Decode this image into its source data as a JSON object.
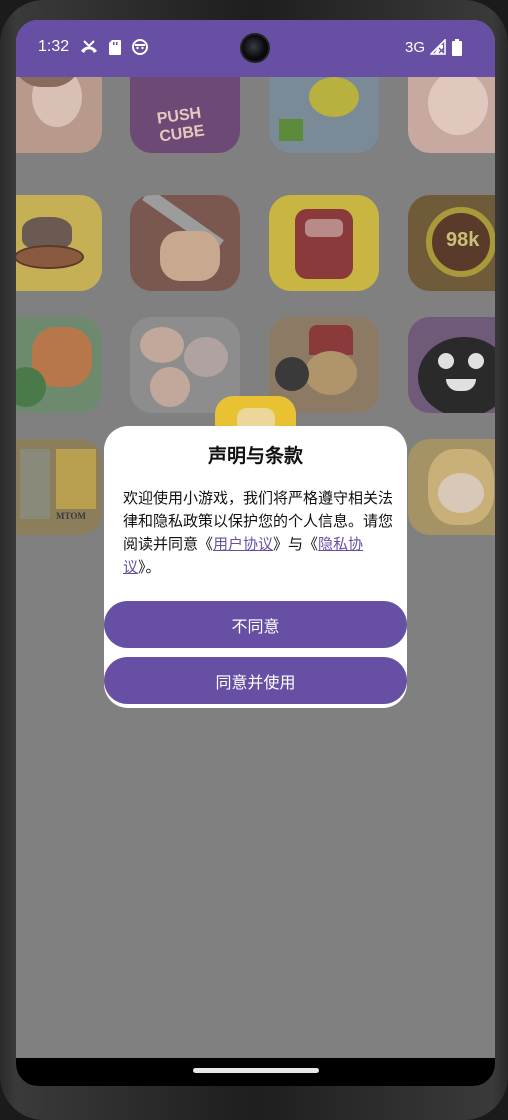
{
  "status_bar": {
    "time": "1:32",
    "network": "3G",
    "icons": [
      "missed-call-icon",
      "sd-card-icon",
      "android-face-icon",
      "signal-icon",
      "battery-icon"
    ],
    "color": "#6750a4"
  },
  "background_games": [
    {
      "name": "anime-girl-game-icon",
      "color": "#b79a8c"
    },
    {
      "name": "push-cube-game-icon",
      "color": "#6d4a76",
      "label": "PUSH CUBE"
    },
    {
      "name": "duck-game-icon",
      "color": "#8a9a78"
    },
    {
      "name": "anime-girl-2-game-icon",
      "color": "#c8a9a0"
    },
    {
      "name": "fish-cat-game-icon",
      "color": "#c6b056"
    },
    {
      "name": "knife-hand-game-icon",
      "color": "#7a5850"
    },
    {
      "name": "red-robot-game-icon",
      "color": "#c9b541"
    },
    {
      "name": "98k-game-icon",
      "color": "#6f5a3a",
      "label": "98k"
    },
    {
      "name": "dragon-game-icon",
      "color": "#6e8a6e"
    },
    {
      "name": "family-comic-game-icon",
      "color": "#8d8d8d"
    },
    {
      "name": "monk-game-icon",
      "color": "#8c7a64"
    },
    {
      "name": "black-blob-game-icon",
      "color": "#6f5a7a"
    },
    {
      "name": "mahjong-game-icon",
      "color": "#8c7e5a",
      "label": "MTOM"
    },
    {
      "name": "blonde-girl-game-icon",
      "color": "#a59366"
    }
  ],
  "dialog": {
    "title": "声明与条款",
    "body_prefix": "欢迎使用小游戏，我们将严格遵守相关法律和隐私政策以保护您的个人信息。请您阅读并同意《",
    "user_agreement_link": "用户协议",
    "body_middle": "》与《",
    "privacy_link": "隐私协议",
    "body_suffix": "》。",
    "disagree_label": "不同意",
    "agree_label": "同意并使用",
    "accent_color": "#6750a4"
  }
}
